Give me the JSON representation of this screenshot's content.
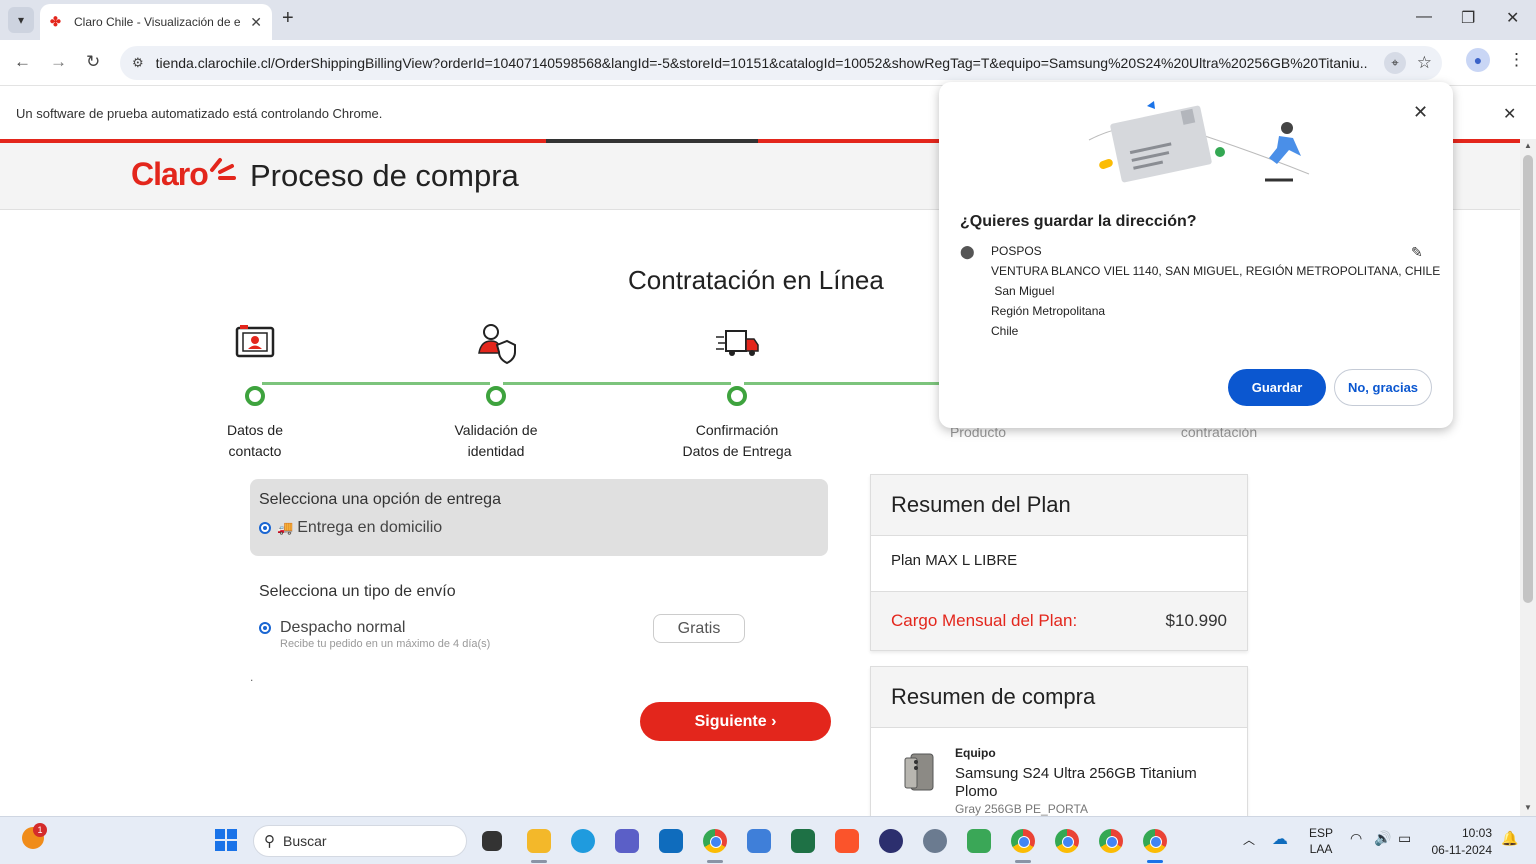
{
  "browser": {
    "tab_title": "Claro Chile - Visualización de e",
    "url": "tienda.clarochile.cl/OrderShippingBillingView?orderId=10407140598568&langId=-5&storeId=10151&catalogId=10052&showRegTag=T&equipo=Samsung%20S24%20Ultra%20256GB%20Titaniu...",
    "infobar_text": "Un software de prueba automatizado está controlando Chrome."
  },
  "site": {
    "logo": "Claro",
    "title": "Proceso de compra"
  },
  "page": {
    "heading": "Contratación en Línea",
    "steps": [
      {
        "line1": "Datos de",
        "line2": "contacto"
      },
      {
        "line1": "Validación de",
        "line2": "identidad"
      },
      {
        "line1": "Confirmación",
        "line2": "Datos de Entrega"
      },
      {
        "line1": "",
        "line2": "Producto"
      },
      {
        "line1": "",
        "line2": "contratación"
      }
    ],
    "delivery": {
      "title": "Selecciona una opción de entrega",
      "option": "Entrega en domicilio"
    },
    "shipping": {
      "title": "Selecciona un tipo de envío",
      "option": "Despacho normal",
      "sub": "Recibe tu pedido en un máximo de 4 día(s)",
      "price": "Gratis"
    },
    "dot": ".",
    "next_button": "Siguiente ›"
  },
  "plan_summary": {
    "title": "Resumen del Plan",
    "plan_name": "Plan MAX L LIBRE",
    "cost_label": "Cargo Mensual del Plan:",
    "cost_value": "$10.990"
  },
  "purchase_summary": {
    "title": "Resumen de compra",
    "tag": "Equipo",
    "name": "Samsung S24 Ultra 256GB Titanium Plomo",
    "sub": "Gray 256GB PE_PORTA"
  },
  "popup": {
    "title": "¿Quieres guardar la dirección?",
    "address": [
      "POSPOS",
      "VENTURA BLANCO VIEL 1140, SAN MIGUEL, REGIÓN METROPOLITANA, CHILE",
      " San Miguel",
      "Región Metropolitana",
      "Chile"
    ],
    "save_button": "Guardar",
    "no_button": "No, gracias"
  },
  "taskbar": {
    "search_placeholder": "Buscar",
    "badge": "1",
    "lang_line1": "ESP",
    "lang_line2": "LAA",
    "time": "10:03",
    "date": "06-11-2024"
  },
  "colors": {
    "brand_red": "#e3261c",
    "progress_green": "#3ea33e",
    "google_blue": "#0b57d0"
  }
}
